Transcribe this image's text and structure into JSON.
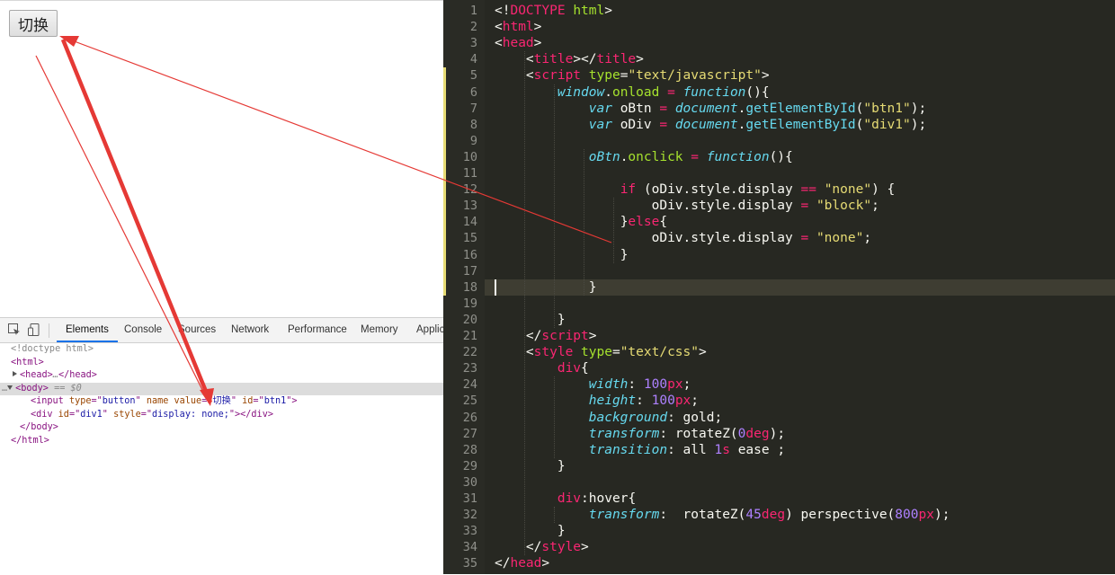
{
  "browser": {
    "button_label": "切换"
  },
  "devtools": {
    "tabs": [
      "Elements",
      "Console",
      "Sources",
      "Network",
      "Performance",
      "Memory",
      "Applic"
    ],
    "active_tab": "Elements",
    "icons": [
      "inspect-element-icon",
      "device-toolbar-icon"
    ],
    "dom": [
      {
        "indent": 12,
        "html": "<span class='t-com'>&lt;!doctype html&gt;</span>"
      },
      {
        "indent": 12,
        "html": "<span class='t-tag'>&lt;html&gt;</span>"
      },
      {
        "indent": 14,
        "tri": "right",
        "html": "<span class='t-tag'>&lt;head&gt;</span><span class='t-dim'>…</span><span class='t-tag'>&lt;/head&gt;</span>"
      },
      {
        "indent": 2,
        "tri": "down",
        "selected": true,
        "prefix": "…",
        "html": "<span class='t-tag'>&lt;body&gt;</span> <span class='t-dim'>== $0</span>"
      },
      {
        "indent": 34,
        "html": "<span class='t-tag'>&lt;input </span><span class='t-attr'>type</span><span class='t-tag'>=\"</span><span class='t-val'>button</span><span class='t-tag'>\" </span><span class='t-attr'>name value</span><span class='t-tag'>=\"</span><span class='t-val'>切换</span><span class='t-tag'>\" </span><span class='t-attr'>id</span><span class='t-tag'>=\"</span><span class='t-val'>btn1</span><span class='t-tag'>\"&gt;</span>"
      },
      {
        "indent": 34,
        "html": "<span class='t-tag'>&lt;div </span><span class='t-attr'>id</span><span class='t-tag'>=\"</span><span class='t-val'>div1</span><span class='t-tag'>\" </span><span class='t-attr'>style</span><span class='t-tag'>=\"</span><span class='t-val'>display: none;</span><span class='t-tag'>\"&gt;&lt;/div&gt;</span>"
      },
      {
        "indent": 22,
        "html": "<span class='t-tag'>&lt;/body&gt;</span>"
      },
      {
        "indent": 12,
        "html": "<span class='t-tag'>&lt;/html&gt;</span>"
      }
    ]
  },
  "editor": {
    "current_line": 18,
    "modified_lines": [
      5,
      18
    ],
    "lines": [
      [
        1,
        "<span class='k-plain'>&lt;!</span><span class='k-tag'>DOCTYPE</span> <span class='k-attr'>html</span><span class='k-plain'>&gt;</span>"
      ],
      [
        2,
        "<span class='k-plain'>&lt;</span><span class='k-tag'>html</span><span class='k-plain'>&gt;</span>"
      ],
      [
        3,
        "<span class='k-plain'>&lt;</span><span class='k-tag'>head</span><span class='k-plain'>&gt;</span>"
      ],
      [
        4,
        "    <span class='k-plain'>&lt;</span><span class='k-tag'>title</span><span class='k-plain'>&gt;&lt;/</span><span class='k-tag'>title</span><span class='k-plain'>&gt;</span>"
      ],
      [
        5,
        "    <span class='k-plain'>&lt;</span><span class='k-tag'>script</span> <span class='k-attr'>type</span><span class='k-plain'>=</span><span class='k-str'>\"text/javascript\"</span><span class='k-plain'>&gt;</span>"
      ],
      [
        6,
        "        <span class='k-kw'>window</span><span class='k-plain'>.</span><span class='k-fn'>onload</span> <span class='k-ctl'>=</span> <span class='k-kw'>function</span><span class='k-plain'>(){</span>"
      ],
      [
        7,
        "            <span class='k-kw'>var</span> <span class='k-plain'>oBtn</span> <span class='k-ctl'>=</span> <span class='k-kw'>document</span><span class='k-plain'>.</span><span class='k-prop' style='font-style:normal'>getElementById</span><span class='k-plain'>(</span><span class='k-str'>\"btn1\"</span><span class='k-plain'>);</span>"
      ],
      [
        8,
        "            <span class='k-kw'>var</span> <span class='k-plain'>oDiv</span> <span class='k-ctl'>=</span> <span class='k-kw'>document</span><span class='k-plain'>.</span><span class='k-prop' style='font-style:normal'>getElementById</span><span class='k-plain'>(</span><span class='k-str'>\"div1\"</span><span class='k-plain'>);</span>"
      ],
      [
        9,
        ""
      ],
      [
        10,
        "            <span class='k-kw'>oBtn</span><span class='k-plain'>.</span><span class='k-fn'>onclick</span> <span class='k-ctl'>=</span> <span class='k-kw'>function</span><span class='k-plain'>(){</span>"
      ],
      [
        11,
        ""
      ],
      [
        12,
        "                <span class='k-ctl'>if</span> <span class='k-plain'>(oDiv.style.display</span> <span class='k-ctl'>==</span> <span class='k-str'>\"none\"</span><span class='k-plain'>) {</span>"
      ],
      [
        13,
        "                    <span class='k-plain'>oDiv.style.display</span> <span class='k-ctl'>=</span> <span class='k-str'>\"block\"</span><span class='k-plain'>;</span>"
      ],
      [
        14,
        "                <span class='k-plain'>}</span><span class='k-ctl'>else</span><span class='k-plain'>{</span>"
      ],
      [
        15,
        "                    <span class='k-plain'>oDiv.style.display</span> <span class='k-ctl'>=</span> <span class='k-str'>\"none\"</span><span class='k-plain'>;</span>"
      ],
      [
        16,
        "                <span class='k-plain'>}</span>"
      ],
      [
        17,
        ""
      ],
      [
        18,
        "            <span class='k-plain'>}</span>"
      ],
      [
        19,
        ""
      ],
      [
        20,
        "        <span class='k-plain'>}</span>"
      ],
      [
        21,
        "    <span class='k-plain'>&lt;/</span><span class='k-tag'>script</span><span class='k-plain'>&gt;</span>"
      ],
      [
        22,
        "    <span class='k-plain'>&lt;</span><span class='k-tag'>style</span> <span class='k-attr'>type</span><span class='k-plain'>=</span><span class='k-str'>\"text/css\"</span><span class='k-plain'>&gt;</span>"
      ],
      [
        23,
        "        <span class='k-sel'>div</span><span class='k-plain'>{</span>"
      ],
      [
        24,
        "            <span class='k-prop'>width</span><span class='k-plain'>:</span> <span class='k-num'>100</span><span class='k-ctl'>px</span><span class='k-plain'>;</span>"
      ],
      [
        25,
        "            <span class='k-prop'>height</span><span class='k-plain'>:</span> <span class='k-num'>100</span><span class='k-ctl'>px</span><span class='k-plain'>;</span>"
      ],
      [
        26,
        "            <span class='k-prop'>background</span><span class='k-plain'>:</span> <span class='k-val'>gold</span><span class='k-plain'>;</span>"
      ],
      [
        27,
        "            <span class='k-prop'>transform</span><span class='k-plain'>:</span> <span class='k-val'>rotateZ(</span><span class='k-num'>0</span><span class='k-ctl'>deg</span><span class='k-val'>)</span><span class='k-plain'>;</span>"
      ],
      [
        28,
        "            <span class='k-prop'>transition</span><span class='k-plain'>:</span> <span class='k-val'>all</span> <span class='k-num'>1</span><span class='k-ctl'>s</span> <span class='k-val'>ease</span> <span class='k-plain'>;</span>"
      ],
      [
        29,
        "        <span class='k-plain'>}</span>"
      ],
      [
        30,
        ""
      ],
      [
        31,
        "        <span class='k-sel'>div</span><span class='k-plain'>:</span><span class='k-fn' style='color:#f8f8f2'>hover</span><span class='k-plain'>{</span>"
      ],
      [
        32,
        "            <span class='k-prop'>transform</span><span class='k-plain'>:</span>  <span class='k-val'>rotateZ(</span><span class='k-num'>45</span><span class='k-ctl'>deg</span><span class='k-val'>)</span> <span class='k-val'>perspective(</span><span class='k-num'>800</span><span class='k-ctl'>px</span><span class='k-val'>)</span><span class='k-plain'>;</span>"
      ],
      [
        33,
        "        <span class='k-plain'>}</span>"
      ],
      [
        34,
        "    <span class='k-plain'>&lt;/</span><span class='k-tag'>style</span><span class='k-plain'>&gt;</span>"
      ],
      [
        35,
        "<span class='k-plain'>&lt;/</span><span class='k-tag'>head</span><span class='k-plain'>&gt;</span>"
      ]
    ]
  },
  "colors": {
    "editor_bg": "#272822",
    "annotation_red": "#e53935",
    "devtools_active_tab": "#1a73e8"
  }
}
